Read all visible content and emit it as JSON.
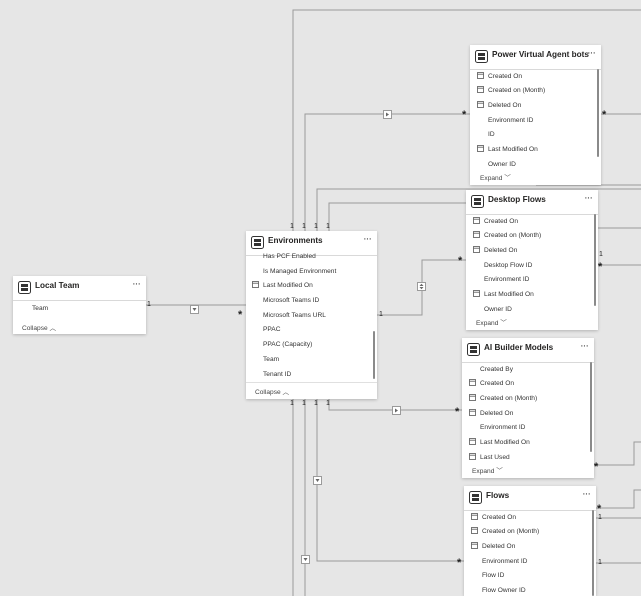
{
  "tables": {
    "local_team": {
      "title": "Local Team",
      "fields": [
        "Team"
      ],
      "footer": "Collapse"
    },
    "environments": {
      "title": "Environments",
      "fields": [
        "Has PCF Enabled",
        "Is Managed Environment",
        "Last Modified On",
        "Microsoft Teams ID",
        "Microsoft Teams URL",
        "PPAC",
        "PPAC (Capacity)",
        "Team",
        "Tenant ID"
      ],
      "footer": "Collapse"
    },
    "pva": {
      "title": "Power Virtual Agent bots",
      "fields": [
        "Created On",
        "Created on (Month)",
        "Deleted On",
        "Environment ID",
        "ID",
        "Last Modified On",
        "Owner ID"
      ],
      "footer": "Expand"
    },
    "desktop": {
      "title": "Desktop Flows",
      "fields": [
        "Created On",
        "Created on (Month)",
        "Deleted On",
        "Desktop Flow ID",
        "Environment ID",
        "Last Modified On",
        "Owner ID"
      ],
      "footer": "Expand"
    },
    "ai": {
      "title": "AI Builder Models",
      "fields": [
        "Created By",
        "Created On",
        "Created on (Month)",
        "Deleted On",
        "Environment ID",
        "Last Modified On",
        "Last Used"
      ],
      "footer": "Expand"
    },
    "flows": {
      "title": "Flows",
      "fields": [
        "Created On",
        "Created on (Month)",
        "Deleted On",
        "Environment ID",
        "Flow ID",
        "Flow Owner ID"
      ]
    }
  },
  "cardinality": {
    "one": "1",
    "many": "*"
  },
  "more_label": "···",
  "colors": {
    "background": "#e6e6e6",
    "line": "#9a9a9a",
    "card": "#ffffff"
  }
}
